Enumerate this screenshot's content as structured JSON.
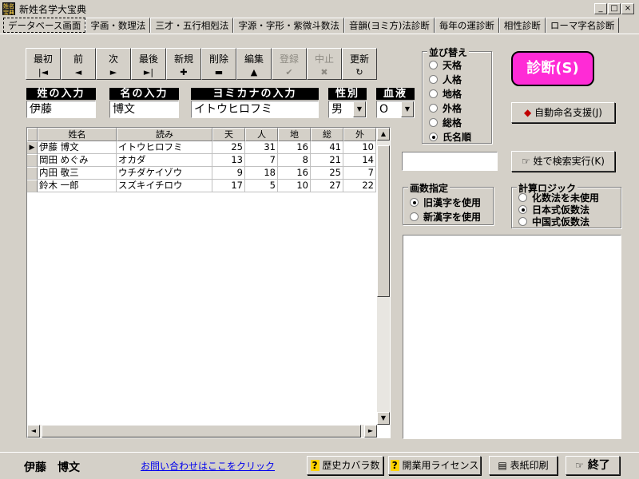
{
  "window": {
    "icon_text": "姓名宝典",
    "title": "新姓名学大宝典",
    "controls": {
      "minimize": "_",
      "maximize": "□",
      "close": "×"
    }
  },
  "tabs": [
    {
      "label": "データベース画面",
      "active": true
    },
    {
      "label": "字画・数理法"
    },
    {
      "label": "三才・五行相剋法"
    },
    {
      "label": "字源・字形・紫微斗数法"
    },
    {
      "label": "音韻(ヨミ方)法診断"
    },
    {
      "label": "毎年の運診断"
    },
    {
      "label": "相性診断"
    },
    {
      "label": "ローマ字名診断"
    }
  ],
  "nav": [
    {
      "label": "最初",
      "icon": "|◄"
    },
    {
      "label": "前",
      "icon": "◄"
    },
    {
      "label": "次",
      "icon": "►"
    },
    {
      "label": "最後",
      "icon": "►|"
    },
    {
      "label": "新規",
      "icon": "✚"
    },
    {
      "label": "削除",
      "icon": "▬"
    },
    {
      "label": "編集",
      "icon": "▲"
    },
    {
      "label": "登録",
      "icon": "✔",
      "disabled": true
    },
    {
      "label": "中止",
      "icon": "✖",
      "disabled": true
    },
    {
      "label": "更新",
      "icon": "↻"
    }
  ],
  "inputs": {
    "surname": {
      "label": "姓の入力",
      "value": "伊藤"
    },
    "given": {
      "label": "名の入力",
      "value": "博文"
    },
    "kana": {
      "label": "ヨミカナの入力",
      "value": "イトウヒロフミ"
    },
    "gender": {
      "label": "性別",
      "value": "男"
    },
    "blood": {
      "label": "血液",
      "value": "O"
    }
  },
  "grid": {
    "columns": [
      "姓名",
      "読み",
      "天",
      "人",
      "地",
      "総",
      "外"
    ],
    "rows": [
      [
        "伊藤 博文",
        "イトウヒロフミ",
        "25",
        "31",
        "16",
        "41",
        "10"
      ],
      [
        "岡田 めぐみ",
        "オカダ",
        "13",
        "7",
        "8",
        "21",
        "14"
      ],
      [
        "内田 敬三",
        "ウチダケイゾウ",
        "9",
        "18",
        "16",
        "25",
        "7"
      ],
      [
        "鈴木 一郎",
        "スズキイチロウ",
        "17",
        "5",
        "10",
        "27",
        "22"
      ]
    ]
  },
  "sort": {
    "title": "並び替え",
    "options": [
      "天格",
      "人格",
      "地格",
      "外格",
      "総格",
      "氏名順"
    ],
    "selected": "氏名順"
  },
  "buttons": {
    "diagnose": "診断(S)",
    "auto_naming": "自動命名支援(J)",
    "surname_search": "姓で検索実行(K)",
    "history": "歴史カバラ数",
    "license": "開業用ライセンス",
    "print": "表紙印刷",
    "exit": "終了"
  },
  "stroke": {
    "title": "画数指定",
    "options": [
      "旧漢字を使用",
      "新漢字を使用"
    ],
    "selected": "旧漢字を使用"
  },
  "logic": {
    "title": "計算ロジック",
    "options": [
      "化数法を未使用",
      "日本式仮数法",
      "中国式仮数法"
    ],
    "selected": "日本式仮数法"
  },
  "status": {
    "name": "伊藤　博文",
    "contact_link": "お問い合わせはここをクリック"
  }
}
